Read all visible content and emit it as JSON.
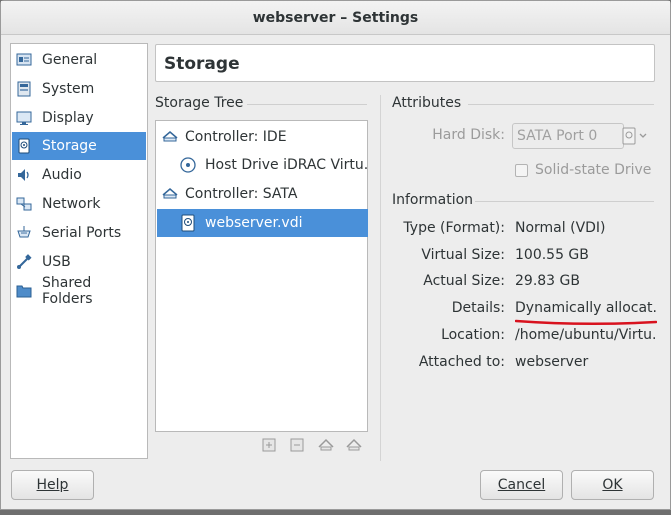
{
  "window": {
    "title": "webserver – Settings"
  },
  "sidebar": {
    "items": [
      {
        "label": "General",
        "icon": "general-icon"
      },
      {
        "label": "System",
        "icon": "system-icon"
      },
      {
        "label": "Display",
        "icon": "display-icon"
      },
      {
        "label": "Storage",
        "icon": "storage-icon",
        "selected": true
      },
      {
        "label": "Audio",
        "icon": "audio-icon"
      },
      {
        "label": "Network",
        "icon": "network-icon"
      },
      {
        "label": "Serial Ports",
        "icon": "serial-ports-icon"
      },
      {
        "label": "USB",
        "icon": "usb-icon"
      },
      {
        "label": "Shared Folders",
        "icon": "shared-folders-icon"
      }
    ]
  },
  "page": {
    "title": "Storage"
  },
  "storage_tree": {
    "heading": "Storage Tree",
    "rows": [
      {
        "label": "Controller: IDE",
        "kind": "controller"
      },
      {
        "label": "Host Drive iDRAC Virtu...",
        "kind": "optical"
      },
      {
        "label": "Controller: SATA",
        "kind": "controller"
      },
      {
        "label": "webserver.vdi",
        "kind": "disk",
        "selected": true
      }
    ]
  },
  "attributes": {
    "heading": "Attributes",
    "hard_disk_label": "Hard Disk:",
    "hard_disk_value": "SATA Port 0",
    "ssd_label": "Solid-state Drive"
  },
  "information": {
    "heading": "Information",
    "rows": [
      {
        "label": "Type (Format):",
        "value": "Normal (VDI)"
      },
      {
        "label": "Virtual Size:",
        "value": "100.55 GB"
      },
      {
        "label": "Actual Size:",
        "value": "29.83 GB"
      },
      {
        "label": "Details:",
        "value": "Dynamically allocat..."
      },
      {
        "label": "Location:",
        "value": "/home/ubuntu/Virtu..."
      },
      {
        "label": "Attached to:",
        "value": "webserver"
      }
    ]
  },
  "buttons": {
    "help": "Help",
    "cancel": "Cancel",
    "ok": "OK"
  },
  "colors": {
    "selection": "#4a90d9",
    "annotation": "#d8121e"
  }
}
